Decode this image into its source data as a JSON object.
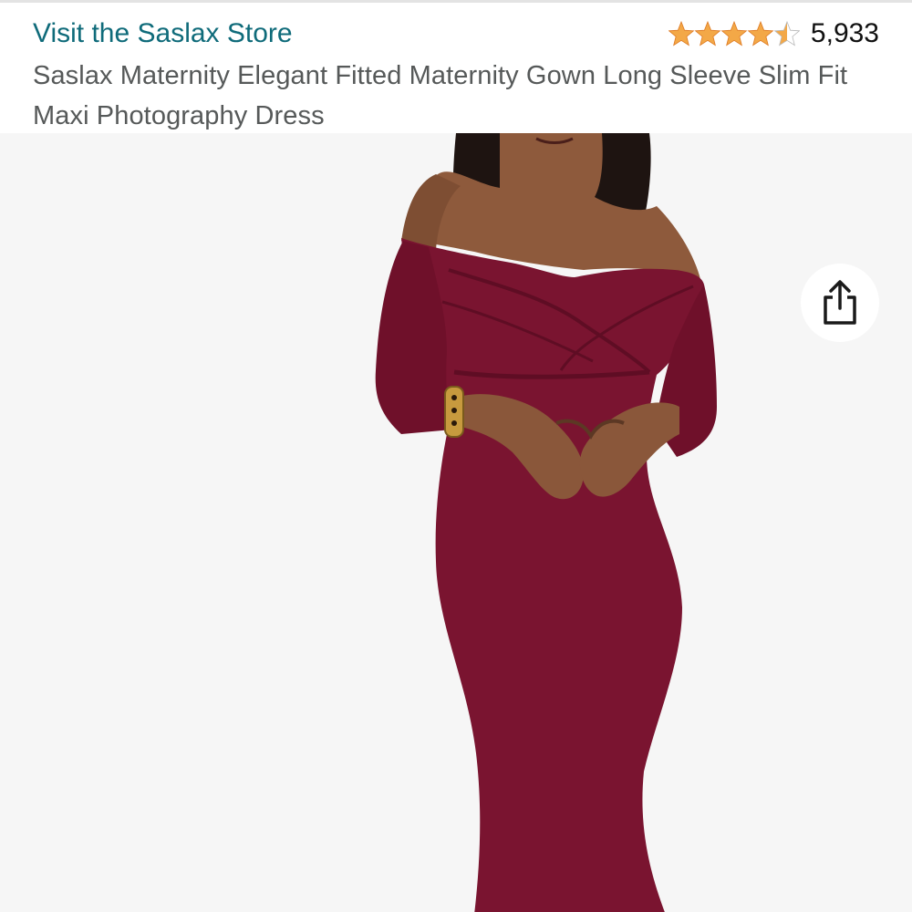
{
  "header": {
    "store_link_label": "Visit the Saslax Store",
    "rating": {
      "stars_value": 4.5,
      "stars_max": 5,
      "count_label": "5,933",
      "star_color": "#f3a847"
    },
    "product_title": "Saslax Maternity Elegant Fitted Maternity Gown Long Sleeve Slim Fit Maxi Photography Dress"
  },
  "gallery": {
    "image_icon": "product-photo-burgundy-maternity-gown",
    "share_icon": "share-icon",
    "background_color": "#f6f6f6"
  },
  "colors": {
    "link": "#0f6b7a",
    "title": "#565959",
    "dress": "#7a1430"
  }
}
